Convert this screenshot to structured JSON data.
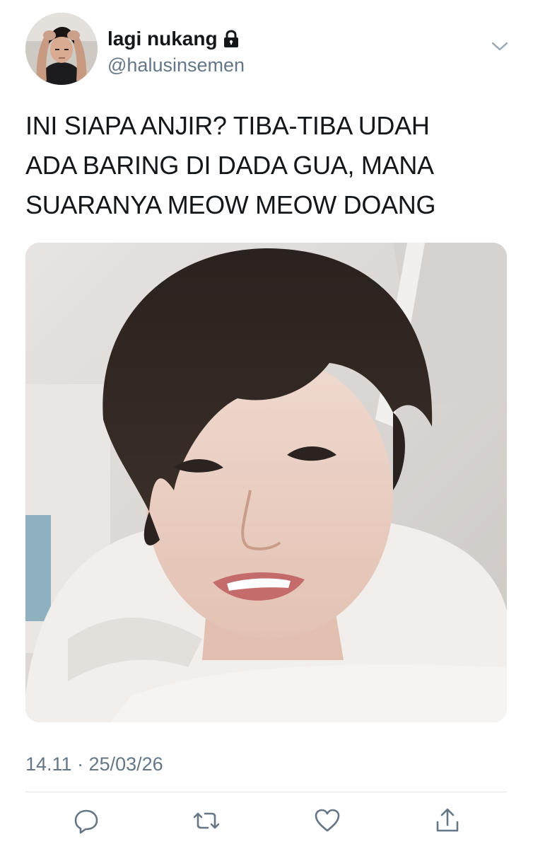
{
  "user": {
    "display_name": "lagi nukang",
    "handle": "@halusinsemen",
    "locked_icon": "lock-icon",
    "avatar": "avatar"
  },
  "menu_icon": "chevron-down-icon",
  "tweet": {
    "lines": [
      "INI SIAPA ANJIR? TIBA-TIBA UDAH",
      "ADA BARING DI DADA GUA, MANA",
      "SUARANYA MEOW MEOW DOANG"
    ],
    "timestamp": "14.11 · 25/03/26"
  },
  "media": {
    "type": "photo"
  },
  "actions": [
    {
      "name": "reply",
      "icon": "reply-icon"
    },
    {
      "name": "retweet",
      "icon": "retweet-icon"
    },
    {
      "name": "like",
      "icon": "heart-icon"
    },
    {
      "name": "share",
      "icon": "share-icon"
    }
  ],
  "colors": {
    "text": "#14171a",
    "secondary": "#657786",
    "divider": "#e1e8ed",
    "icon": "#657786"
  }
}
